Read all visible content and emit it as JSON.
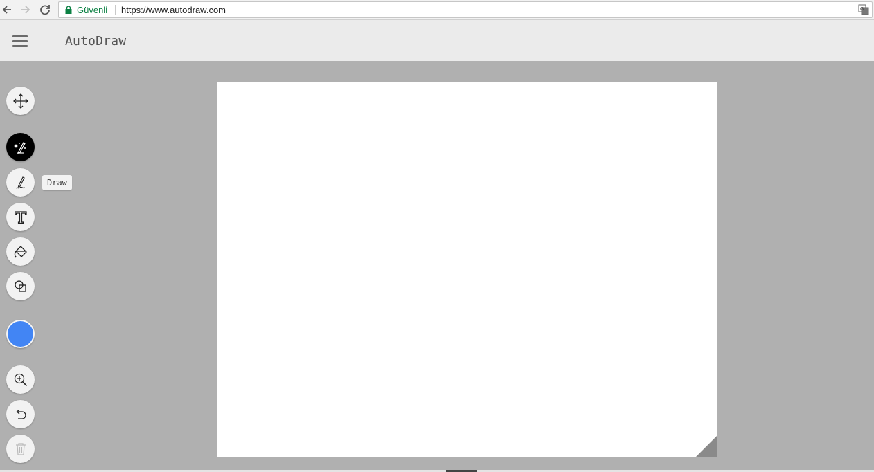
{
  "browser": {
    "secure_label": "Güvenli",
    "url": "https://www.autodraw.com"
  },
  "app": {
    "title": "AutoDraw"
  },
  "toolbar": {
    "tooltip": "Draw",
    "current_color": "#4285f4",
    "tools": [
      {
        "name": "select-move",
        "icon": "move-arrows-icon"
      },
      {
        "name": "autodraw",
        "icon": "autodraw-pencil-sparkle-icon",
        "active": true
      },
      {
        "name": "draw",
        "icon": "pencil-icon"
      },
      {
        "name": "type",
        "icon": "text-t-icon"
      },
      {
        "name": "fill",
        "icon": "paint-bucket-icon"
      },
      {
        "name": "shape",
        "icon": "shapes-icon"
      },
      {
        "name": "zoom",
        "icon": "zoom-in-icon"
      },
      {
        "name": "undo",
        "icon": "undo-icon"
      },
      {
        "name": "delete",
        "icon": "trash-icon",
        "disabled": true
      }
    ]
  },
  "colors": {
    "accent": "#4285f4",
    "header_bg": "#ebebeb",
    "workspace_bg": "#b0b0b0",
    "canvas_bg": "#ffffff"
  }
}
